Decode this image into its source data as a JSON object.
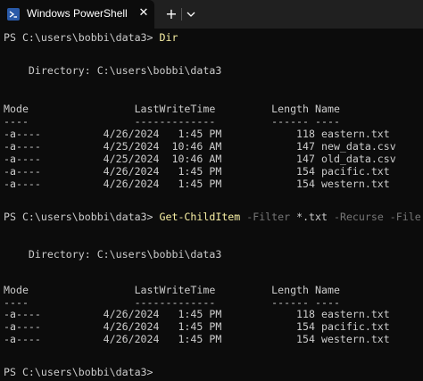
{
  "window": {
    "tab_title": "Windows PowerShell",
    "close_glyph": "✕",
    "new_tab_glyph": "+"
  },
  "colors": {
    "background": "#0c0c0c",
    "foreground": "#cccccc",
    "command": "#f9f1a5",
    "parameter": "#767676"
  },
  "icons": {
    "tab_icon": "powershell-icon",
    "dropdown": "chevron-down-icon"
  },
  "terminal": {
    "prompt1": "PS C:\\users\\bobbi\\data3> ",
    "cmd1": "Dir",
    "dir_header1": "    Directory: C:\\users\\bobbi\\data3",
    "cols_header1": "Mode                 LastWriteTime         Length Name",
    "cols_under1": "----                 -------------         ------ ----",
    "rows1": [
      "-a----          4/26/2024   1:45 PM            118 eastern.txt",
      "-a----          4/25/2024  10:46 AM            147 new_data.csv",
      "-a----          4/25/2024  10:46 AM            147 old_data.csv",
      "-a----          4/26/2024   1:45 PM            154 pacific.txt",
      "-a----          4/26/2024   1:45 PM            154 western.txt"
    ],
    "prompt2": "PS C:\\users\\bobbi\\data3> ",
    "cmd2": "Get-ChildItem",
    "param2a": " -Filter ",
    "arg2": "*.txt",
    "param2b": " -Recurse -File",
    "dir_header2": "    Directory: C:\\users\\bobbi\\data3",
    "cols_header2": "Mode                 LastWriteTime         Length Name",
    "cols_under2": "----                 -------------         ------ ----",
    "rows2": [
      "-a----          4/26/2024   1:45 PM            118 eastern.txt",
      "-a----          4/26/2024   1:45 PM            154 pacific.txt",
      "-a----          4/26/2024   1:45 PM            154 western.txt"
    ],
    "prompt3": "PS C:\\users\\bobbi\\data3>"
  }
}
